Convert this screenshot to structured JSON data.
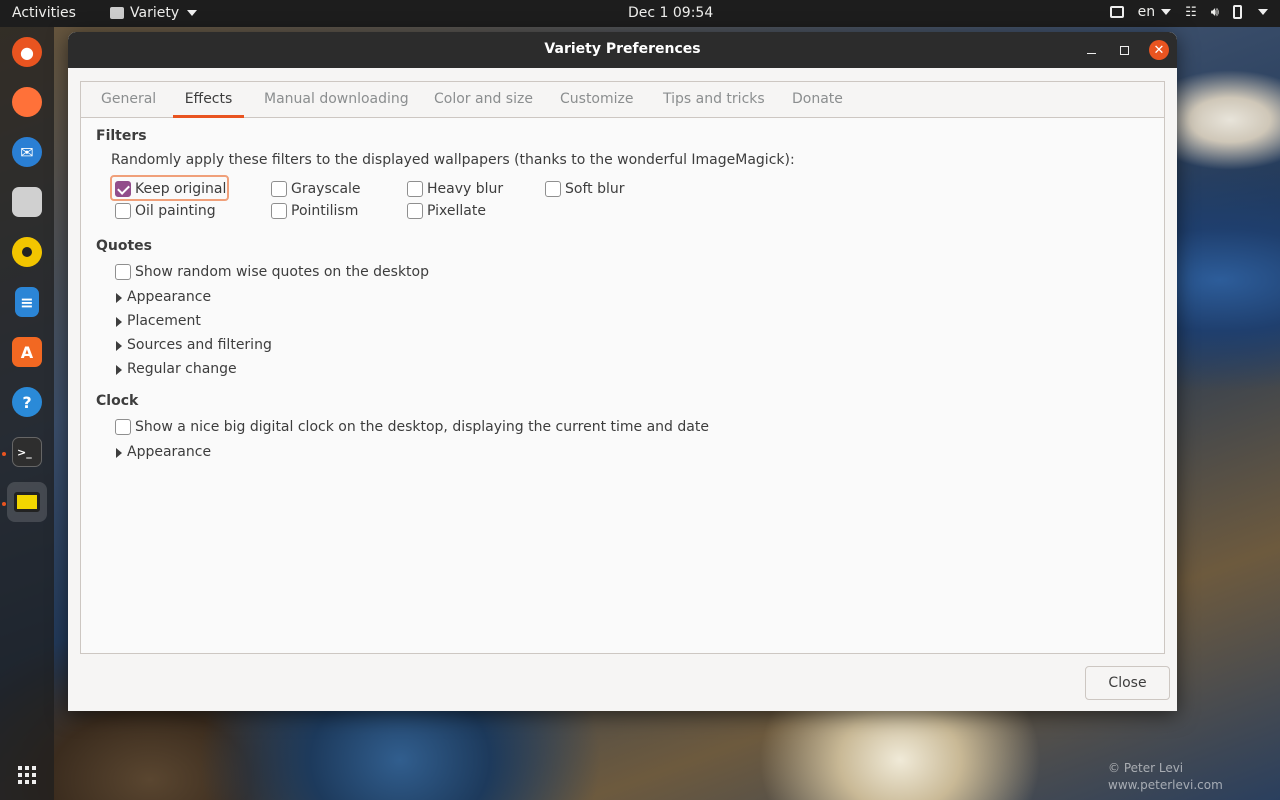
{
  "topbar": {
    "activities": "Activities",
    "app_name": "Variety",
    "clock": "Dec 1  09:54",
    "lang": "en"
  },
  "dock": {
    "items": [
      {
        "name": "ubuntu-software-icon",
        "color": "#e95420"
      },
      {
        "name": "firefox-icon",
        "color": "#ff7139"
      },
      {
        "name": "thunderbird-icon",
        "color": "#2a7fd4"
      },
      {
        "name": "files-icon",
        "color": "#d0d0d0"
      },
      {
        "name": "rhythmbox-icon",
        "color": "#f2c500"
      },
      {
        "name": "libreoffice-writer-icon",
        "color": "#2b85d6"
      },
      {
        "name": "app-store-icon",
        "color": "#f26822"
      },
      {
        "name": "help-icon",
        "color": "#2a8ad8"
      },
      {
        "name": "terminal-icon",
        "color": "#2e2e2e"
      },
      {
        "name": "variety-icon",
        "color": "#f2d600"
      }
    ],
    "show_apps_icon": "grid-icon"
  },
  "window": {
    "title": "Variety Preferences",
    "close_label": "Close"
  },
  "tabs": [
    "General",
    "Effects",
    "Manual downloading",
    "Color and size",
    "Customize",
    "Tips and tricks",
    "Donate"
  ],
  "active_tab": "Effects",
  "filters": {
    "title": "Filters",
    "description": "Randomly apply these filters to the displayed wallpapers (thanks to the wonderful ImageMagick):",
    "items": [
      {
        "label": "Keep original",
        "checked": true
      },
      {
        "label": "Grayscale",
        "checked": false
      },
      {
        "label": "Heavy blur",
        "checked": false
      },
      {
        "label": "Soft blur",
        "checked": false
      },
      {
        "label": "Oil painting",
        "checked": false
      },
      {
        "label": "Pointilism",
        "checked": false
      },
      {
        "label": "Pixellate",
        "checked": false
      }
    ]
  },
  "quotes": {
    "title": "Quotes",
    "show_label": "Show random wise quotes on the desktop",
    "expanders": [
      "Appearance",
      "Placement",
      "Sources and filtering",
      "Regular change"
    ]
  },
  "clock": {
    "title": "Clock",
    "show_label": "Show a nice big digital clock on the desktop, displaying the current time and date",
    "expanders": [
      "Appearance"
    ]
  },
  "credit": {
    "line1": "© Peter Levi",
    "line2": "www.peterlevi.com"
  },
  "colors": {
    "accent": "#e95420",
    "checkbox": "#924d8b"
  }
}
